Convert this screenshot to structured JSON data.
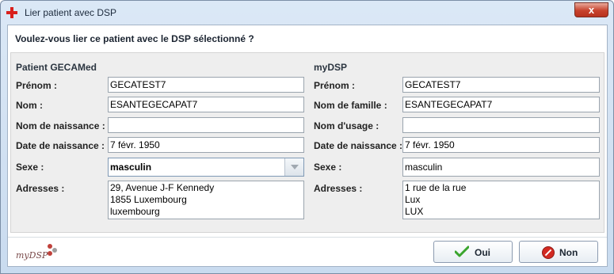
{
  "window": {
    "title": "Lier patient avec DSP",
    "close_glyph": "x"
  },
  "question": "Voulez-vous lier ce patient avec le DSP sélectionné ?",
  "left": {
    "title": "Patient GECAMed",
    "labels": {
      "prenom": "Prénom :",
      "nom": "Nom :",
      "naissance_nom": "Nom de naissance :",
      "date": "Date de naissance :",
      "sexe": "Sexe :",
      "adresses": "Adresses :"
    },
    "values": {
      "prenom": "GECATEST7",
      "nom": "ESANTEGECAPAT7",
      "naissance_nom": "",
      "date": "7 févr. 1950",
      "sexe": "masculin"
    },
    "address_lines": [
      "29, Avenue J-F Kennedy",
      "1855 Luxembourg",
      "luxembourg"
    ]
  },
  "right": {
    "title": "myDSP",
    "labels": {
      "prenom": "Prénom :",
      "nom": "Nom de famille :",
      "usage": "Nom d'usage :",
      "date": "Date de naissance :",
      "sexe": "Sexe :",
      "adresses": "Adresses :"
    },
    "values": {
      "prenom": "GECATEST7",
      "nom": "ESANTEGECAPAT7",
      "usage": "",
      "date": "7 févr. 1950",
      "sexe": "masculin"
    },
    "address_lines": [
      "1 rue de la rue",
      "Lux",
      "LUX"
    ]
  },
  "footer": {
    "logo_text": "myDSP",
    "ok_label": "Oui",
    "no_label": "Non"
  },
  "colors": {
    "accent_red": "#d9201d",
    "ok_green": "#3aa52d",
    "logo_dots": [
      "#c0413b",
      "#9e9e9e",
      "#c0413b"
    ]
  }
}
